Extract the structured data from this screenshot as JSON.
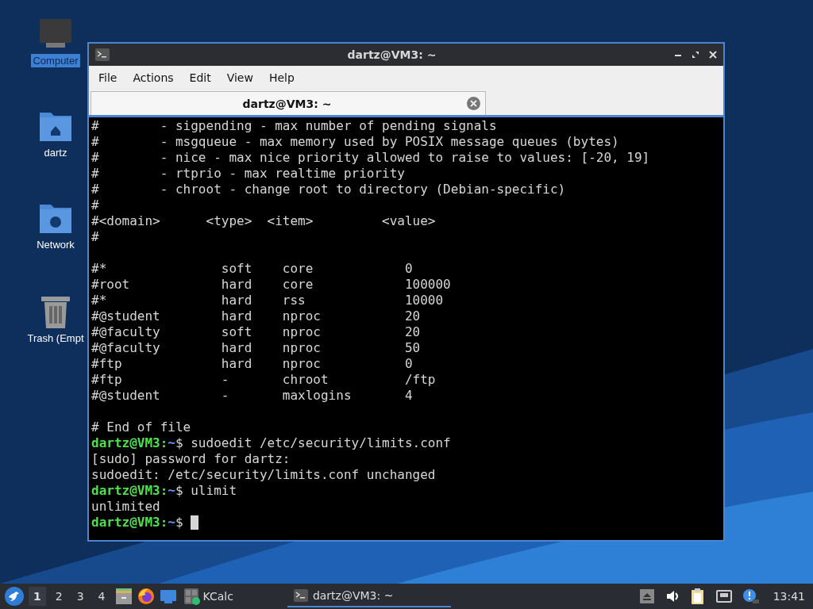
{
  "desktop_icons": [
    {
      "label": "Computer",
      "kind": "computer",
      "selected": true
    },
    {
      "label": "dartz",
      "kind": "home",
      "selected": false
    },
    {
      "label": "Network",
      "kind": "network",
      "selected": false
    },
    {
      "label": "Trash (Empt",
      "kind": "trash",
      "selected": false
    }
  ],
  "window": {
    "title": "dartz@VM3: ~",
    "menu": [
      "File",
      "Actions",
      "Edit",
      "View",
      "Help"
    ],
    "tabs": [
      {
        "label": "dartz@VM3: ~",
        "selected": true
      }
    ],
    "terminal": [
      {
        "kind": "text",
        "text": "#        - sigpending - max number of pending signals"
      },
      {
        "kind": "text",
        "text": "#        - msgqueue - max memory used by POSIX message queues (bytes)"
      },
      {
        "kind": "text",
        "text": "#        - nice - max nice priority allowed to raise to values: [-20, 19]"
      },
      {
        "kind": "text",
        "text": "#        - rtprio - max realtime priority"
      },
      {
        "kind": "text",
        "text": "#        - chroot - change root to directory (Debian-specific)"
      },
      {
        "kind": "text",
        "text": "#"
      },
      {
        "kind": "text",
        "text": "#<domain>      <type>  <item>         <value>"
      },
      {
        "kind": "text",
        "text": "#"
      },
      {
        "kind": "blank"
      },
      {
        "kind": "text",
        "text": "#*               soft    core            0"
      },
      {
        "kind": "text",
        "text": "#root            hard    core            100000"
      },
      {
        "kind": "text",
        "text": "#*               hard    rss             10000"
      },
      {
        "kind": "text",
        "text": "#@student        hard    nproc           20"
      },
      {
        "kind": "text",
        "text": "#@faculty        soft    nproc           20"
      },
      {
        "kind": "text",
        "text": "#@faculty        hard    nproc           50"
      },
      {
        "kind": "text",
        "text": "#ftp             hard    nproc           0"
      },
      {
        "kind": "text",
        "text": "#ftp             -       chroot          /ftp"
      },
      {
        "kind": "text",
        "text": "#@student        -       maxlogins       4"
      },
      {
        "kind": "blank"
      },
      {
        "kind": "text",
        "text": "# End of file"
      },
      {
        "kind": "prompt",
        "user": "dartz@VM3:",
        "path": "~",
        "command": "$ sudoedit /etc/security/limits.conf"
      },
      {
        "kind": "text",
        "text": "[sudo] password for dartz:"
      },
      {
        "kind": "text",
        "text": "sudoedit: /etc/security/limits.conf unchanged"
      },
      {
        "kind": "prompt",
        "user": "dartz@VM3:",
        "path": "~",
        "command": "$ ulimit"
      },
      {
        "kind": "text",
        "text": "unlimited"
      },
      {
        "kind": "prompt",
        "user": "dartz@VM3:",
        "path": "~",
        "command": "$",
        "cursor": true
      }
    ]
  },
  "taskbar": {
    "workspaces": [
      {
        "label": "1",
        "selected": true
      },
      {
        "label": "2",
        "selected": false
      },
      {
        "label": "3",
        "selected": false
      },
      {
        "label": "4",
        "selected": false
      }
    ],
    "launchers": [
      {
        "kind": "files"
      },
      {
        "kind": "browser"
      },
      {
        "kind": "desktop"
      },
      {
        "kind": "calculator",
        "label": "KCalc"
      }
    ],
    "tasks": [
      {
        "label": "dartz@VM3: ~",
        "selected": true
      }
    ],
    "tray": [
      {
        "kind": "eject"
      },
      {
        "kind": "volume"
      },
      {
        "kind": "clipboard"
      },
      {
        "kind": "network"
      },
      {
        "kind": "notification"
      }
    ],
    "clock": "13:41"
  }
}
